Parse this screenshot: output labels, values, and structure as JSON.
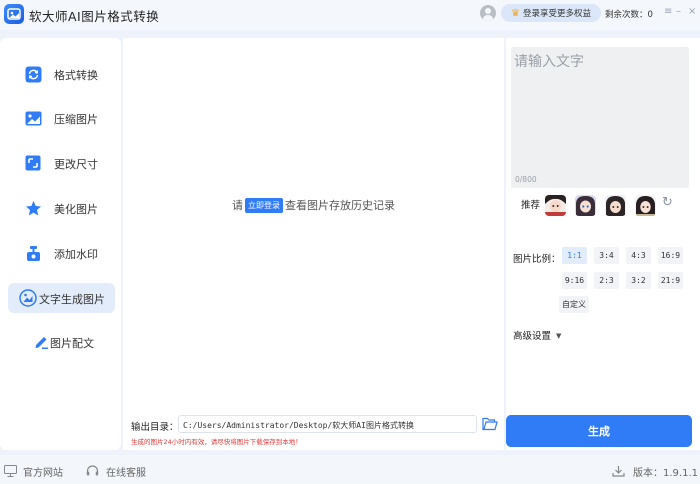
{
  "app": {
    "title": "软大师AI图片格式转换"
  },
  "header": {
    "vip_label": "登录享受更多权益",
    "remaining": "剩余次数：0"
  },
  "window": {
    "menu_icon": "≡",
    "min_icon": "–",
    "close_icon": "×"
  },
  "sidebar": {
    "items": [
      {
        "label": "格式转换",
        "icon": "convert-icon"
      },
      {
        "label": "压缩图片",
        "icon": "image-compress-icon"
      },
      {
        "label": "更改尺寸",
        "icon": "resize-icon"
      },
      {
        "label": "美化图片",
        "icon": "star-icon"
      },
      {
        "label": "添加水印",
        "icon": "watermark-icon"
      },
      {
        "label": "文字生成图片",
        "icon": "text-to-image-icon",
        "active": true
      },
      {
        "label": "图片配文",
        "icon": "pen-icon"
      }
    ]
  },
  "main": {
    "hint_prefix": "请",
    "hint_button": "立即登录",
    "hint_suffix": "查看图片存放历史记录",
    "output_label": "输出目录：",
    "output_path": "C:/Users/Administrator/Desktop/软大师AI图片格式转换",
    "warning": "生成的图片24小时内有效，请尽快将图片下载保存到本地！"
  },
  "right": {
    "prompt_placeholder": "请输入文字",
    "counter": "0/800",
    "recommend_label": "推荐",
    "ratio_label": "图片比例：",
    "ratios": [
      "1:1",
      "3:4",
      "4:3",
      "16:9",
      "9:16",
      "2:3",
      "3:2",
      "21:9",
      "自定义"
    ],
    "selected_ratio": "1:1",
    "advanced_label": "高级设置",
    "generate_label": "生成"
  },
  "footer": {
    "website": "官方网站",
    "support": "在线客服",
    "version": "版本：1.9.1.1"
  },
  "colors": {
    "accent": "#2f7cf6",
    "warning": "#e13a3a"
  }
}
